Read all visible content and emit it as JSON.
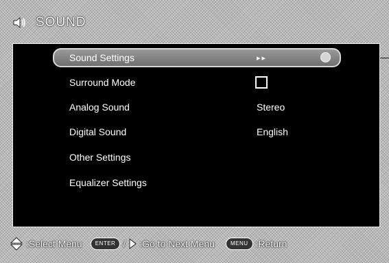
{
  "header": {
    "title": "SOUND",
    "icon": "speaker-icon"
  },
  "menu": {
    "items": [
      {
        "label": "Sound Settings",
        "value": "▸▸",
        "selected": true
      },
      {
        "label": "Surround Mode",
        "value": "",
        "checkbox": true
      },
      {
        "label": "Analog Sound",
        "value": "Stereo"
      },
      {
        "label": "Digital Sound",
        "value": "English"
      },
      {
        "label": "Other Settings",
        "value": ""
      },
      {
        "label": "Equalizer Settings",
        "value": ""
      }
    ]
  },
  "footer": {
    "select_text": ":Select Menu",
    "enter_key": "ENTER",
    "slash": "/",
    "next_text": ":Go to Next Menu",
    "menu_key": "MENU",
    "return_text": ":Return"
  },
  "colors": {
    "panel_bg": "#000000",
    "highlight": "#8a8a8a",
    "text": "#ffffff"
  }
}
